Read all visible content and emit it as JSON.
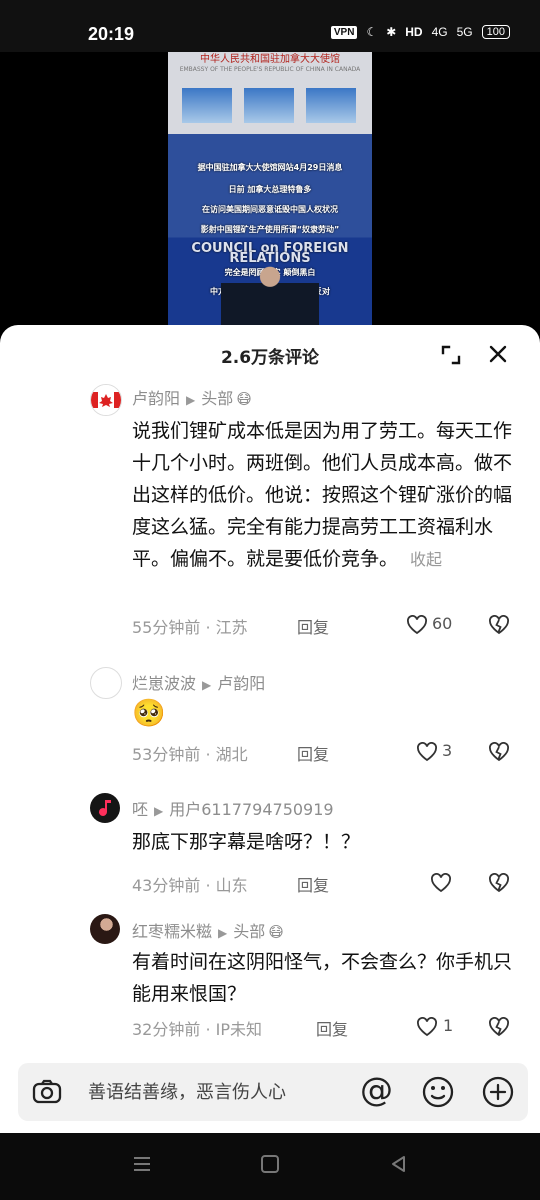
{
  "status": {
    "time": "20:19",
    "vpn": "VPN",
    "network": "4G",
    "network2": "5G",
    "battery": "100"
  },
  "video": {
    "embassy_title": "中华人民共和国驻加拿大大使馆",
    "embassy_sub": "EMBASSY OF THE PEOPLE'S REPUBLIC OF CHINA IN CANADA",
    "caption_lines": [
      "据中国驻加拿大大使馆网站4月29日消息",
      "日前 加拿大总理特鲁多",
      "在访问美国期间恶意诋毁中国人权状况",
      "影射中国锂矿生产使用所谓“奴隶劳动”",
      "完全是罔顾事实 颠倒黑白",
      "中方对此表示强烈不满和坚决反对"
    ],
    "background_text": "COUNCIL on FOREIGN RELATIONS"
  },
  "sheet": {
    "title": "2.6万条评论"
  },
  "comments": [
    {
      "name": "卢韵阳",
      "target": "头部",
      "emoji": "😷",
      "text": "说我们锂矿成本低是因为用了劳工。每天工作十几个小时。两班倒。他们人员成本高。做不出这样的低价。他说：按照这个锂矿涨价的幅度这么猛。完全有能力提高劳工工资福利水平。偏偏不。就是要低价竞争。",
      "collapse": "收起",
      "time": "55分钟前 · 江苏",
      "reply": "回复",
      "likes": "60"
    },
    {
      "name": "烂崽波波",
      "target": "卢韵阳",
      "emoji": "",
      "text": "🥺",
      "time": "53分钟前 · 湖北",
      "reply": "回复",
      "likes": "3"
    },
    {
      "name": "呸",
      "target": "用户6117794750919",
      "emoji": "",
      "text": "那底下那字幕是啥呀？！？",
      "time": "43分钟前 · 山东",
      "reply": "回复",
      "likes": ""
    },
    {
      "name": "红枣糯米糍",
      "target": "头部",
      "emoji": "😷",
      "text": "有着时间在这阴阳怪气，不会查么？你手机只能用来恨国？",
      "time": "32分钟前 · IP未知",
      "reply": "回复",
      "likes": "1"
    }
  ],
  "input": {
    "placeholder": "善语结善缘，恶言伤人心",
    "at": "@"
  }
}
